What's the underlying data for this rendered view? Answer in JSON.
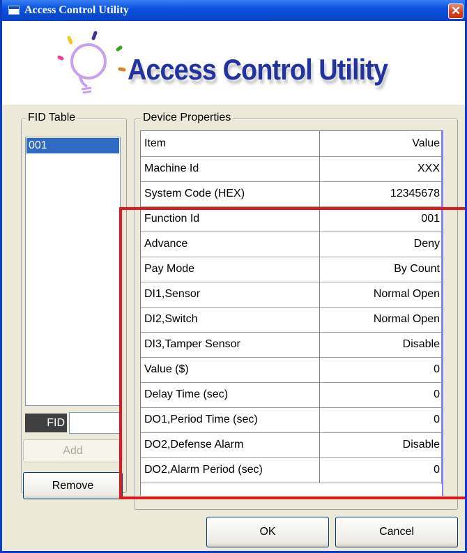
{
  "window": {
    "title": "Access Control Utility",
    "close_icon": "close-icon",
    "accent_color": "#0a52df"
  },
  "banner": {
    "title": "Access Control Utility",
    "logo_icon": "lightbulb-logo-icon"
  },
  "fid_table": {
    "group_label": "FID Table",
    "items": [
      "001"
    ],
    "fid_label": "FID",
    "fid_value": "",
    "add_label": "Add",
    "remove_label": "Remove"
  },
  "device_properties": {
    "group_label": "Device Properties",
    "header": {
      "item": "Item",
      "value": "Value"
    },
    "rows": [
      {
        "item": "Machine Id",
        "value": "XXX"
      },
      {
        "item": "System Code (HEX)",
        "value": "12345678"
      },
      {
        "item": "Function Id",
        "value": "001"
      },
      {
        "item": "Advance",
        "value": "Deny"
      },
      {
        "item": "Pay Mode",
        "value": "By Count"
      },
      {
        "item": "DI1,Sensor",
        "value": "Normal Open"
      },
      {
        "item": "DI2,Switch",
        "value": "Normal Open"
      },
      {
        "item": "DI3,Tamper Sensor",
        "value": "Disable"
      },
      {
        "item": "Value ($)",
        "value": "0"
      },
      {
        "item": "Delay Time (sec)",
        "value": "0"
      },
      {
        "item": "DO1,Period Time (sec)",
        "value": "0"
      },
      {
        "item": "DO2,Defense Alarm",
        "value": "Disable"
      },
      {
        "item": "DO2,Alarm Period (sec)",
        "value": "0"
      }
    ]
  },
  "buttons": {
    "ok_label": "OK",
    "cancel_label": "Cancel"
  },
  "highlight_color": "#e0191e"
}
